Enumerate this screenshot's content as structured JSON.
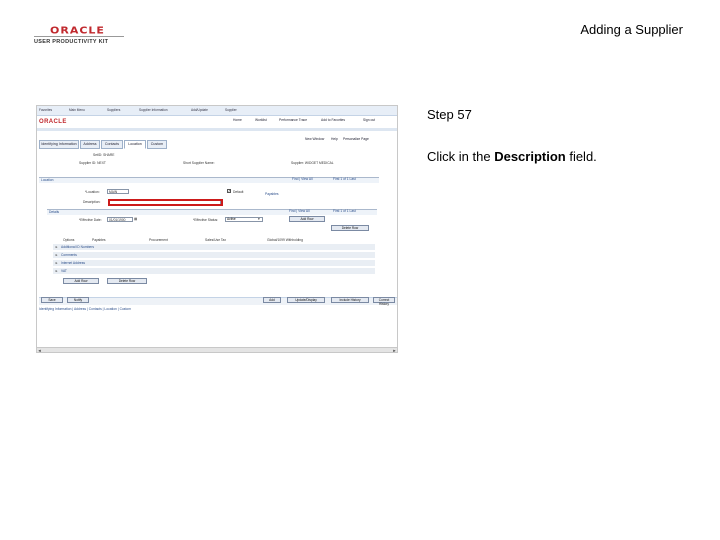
{
  "slide": {
    "logo_primary": "ORACLE",
    "logo_secondary": "USER PRODUCTIVITY KIT",
    "title": "Adding a Supplier",
    "step_label": "Step 57",
    "instruction_pre": "Click in the ",
    "instruction_bold": "Description",
    "instruction_post": " field."
  },
  "app": {
    "brand": "ORACLE",
    "breadcrumbs": [
      "Favorites",
      "Main Menu",
      "Suppliers",
      "Supplier Information",
      "Add/Update",
      "Supplier"
    ],
    "top_links": [
      "Home",
      "Worklist",
      "Performance Trace",
      "Add to Favorites",
      "Sign out"
    ],
    "sub_links": [
      "New Window",
      "Help",
      "Personalize Page"
    ],
    "tabs": [
      "Identifying Information",
      "Address",
      "Contacts",
      "Location",
      "Custom"
    ],
    "active_tab": "Location",
    "fields": {
      "setid_label": "SetID: SHARE",
      "supplier_id_label": "Supplier ID: NEXT",
      "short_name_label": "Short Supplier Name:",
      "supplier_name_label": "Supplier: WIDGET MEDICAL",
      "location_section": "Location",
      "location_label": "*Location:",
      "location_value": "MAIN",
      "default_label": "Default",
      "description_label": "Description:",
      "payables_label": "Payables",
      "effdt_label": "*Effective Date:",
      "effdt_value": "01/01/1900",
      "status_label": "*Effective Status:",
      "status_value": "Active",
      "details_section": "Details",
      "find_view_1": "Find | View All",
      "first_last_1": "First 1 of 1 Last",
      "find_view_2": "Find | View All",
      "first_last_2": "First 1 of 1 Last"
    },
    "grid_headers": [
      "Options",
      "Payables",
      "Procurement",
      "Sales/Use Tax",
      "Global/1099 Withholding"
    ],
    "grid_rows": [
      "Additional ID Numbers",
      "Comments",
      "Internet Address",
      "VAT"
    ],
    "buttons": {
      "add_row": "Add Row",
      "delete_row": "Delete Row",
      "save": "Save",
      "notify": "Notify",
      "add": "Add",
      "update_display": "Update/Display",
      "include_history": "Include History",
      "correct_history": "Correct History"
    },
    "footer_links": "Identifying Information | Address | Contacts | Location | Custom",
    "scroll_left": "◄",
    "scroll_right": "►"
  }
}
